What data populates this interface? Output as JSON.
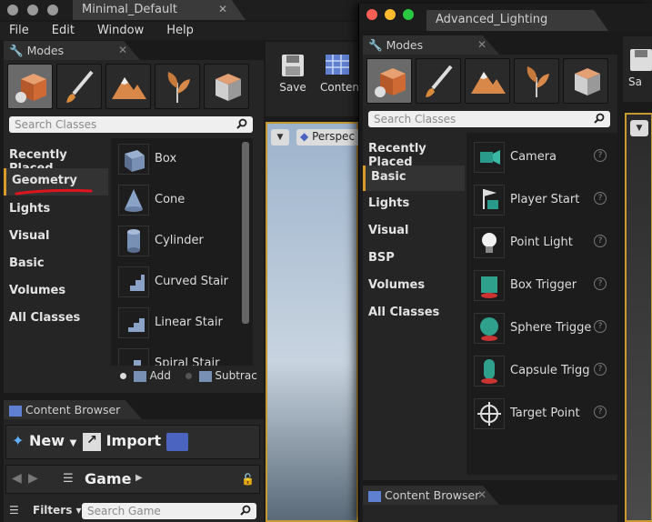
{
  "window1": {
    "title": "Minimal_Default",
    "menu": [
      "File",
      "Edit",
      "Window",
      "Help"
    ],
    "modes_tab": "Modes",
    "search_placeholder": "Search Classes",
    "categories": [
      "Recently Placed",
      "Geometry",
      "Lights",
      "Visual",
      "Basic",
      "Volumes",
      "All Classes"
    ],
    "selected_category": "Geometry",
    "items": [
      "Box",
      "Cone",
      "Cylinder",
      "Curved Stair",
      "Linear Stair",
      "Spiral Stair"
    ],
    "add_label": "Add",
    "subtract_label": "Subtrac",
    "toolbar": {
      "save": "Save",
      "content": "Conten"
    },
    "viewport_label": "Perspec",
    "content_browser": {
      "tab": "Content Browser",
      "new_label": "New",
      "import_label": "Import",
      "path_label": "Game",
      "filters_label": "Filters",
      "search_placeholder": "Search Game"
    }
  },
  "window2": {
    "title": "Advanced_Lighting",
    "modes_tab": "Modes",
    "search_placeholder": "Search Classes",
    "categories": [
      "Recently Placed",
      "Basic",
      "Lights",
      "Visual",
      "BSP",
      "Volumes",
      "All Classes"
    ],
    "selected_category": "Basic",
    "items": [
      "Camera",
      "Player Start",
      "Point Light",
      "Box Trigger",
      "Sphere Trigge",
      "Capsule Trigg",
      "Target Point"
    ],
    "toolbar": {
      "save": "Sa"
    },
    "content_browser_tab": "Content Browser"
  },
  "colors": {
    "accent": "#d89a28",
    "annotation": "#e0141e",
    "close_red": "#ff5f57",
    "min_yellow": "#febc2e",
    "max_green": "#28c840"
  }
}
